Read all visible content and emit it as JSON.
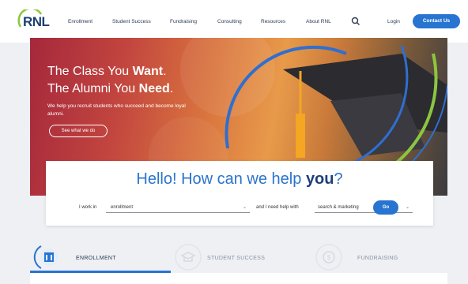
{
  "header": {
    "logo_text": "RNL",
    "nav": [
      "Enrollment",
      "Student Success",
      "Fundraising",
      "Consulting",
      "Resources",
      "About RNL"
    ],
    "login_label": "Login",
    "contact_label": "Contact Us"
  },
  "hero": {
    "title_line1_regular": "The Class You ",
    "title_line1_bold": "Want",
    "title_line1_end": ".",
    "title_line2_regular": "The Alumni You ",
    "title_line2_bold": "Need",
    "title_line2_end": ".",
    "subtitle": "We help you recruit students who succeed and become loyal alumni.",
    "button_label": "See what we do"
  },
  "help": {
    "title_regular": "Hello! How can we help ",
    "title_bold": "you",
    "title_end": "?",
    "work_label": "I work in",
    "work_value": "enrollment",
    "help_label": "and I need help with",
    "help_value": "search & marketing",
    "go_label": "Go"
  },
  "tabs": [
    {
      "label": "ENROLLMENT",
      "active": true
    },
    {
      "label": "STUDENT SUCCESS",
      "active": false
    },
    {
      "label": "FUNDRAISING",
      "active": false
    }
  ],
  "colors": {
    "brand_blue": "#2774d1",
    "navy": "#1d3f7a",
    "arc_blue": "#2f6fd0",
    "arc_green": "#8cc63f",
    "tassel_orange": "#f5a623"
  },
  "icons": {
    "search": "search-icon",
    "tab_enrollment": "enrollment-icon",
    "tab_student_success": "student-success-icon",
    "tab_fundraising": "fundraising-icon",
    "dropdown": "chevron-down-icon"
  }
}
